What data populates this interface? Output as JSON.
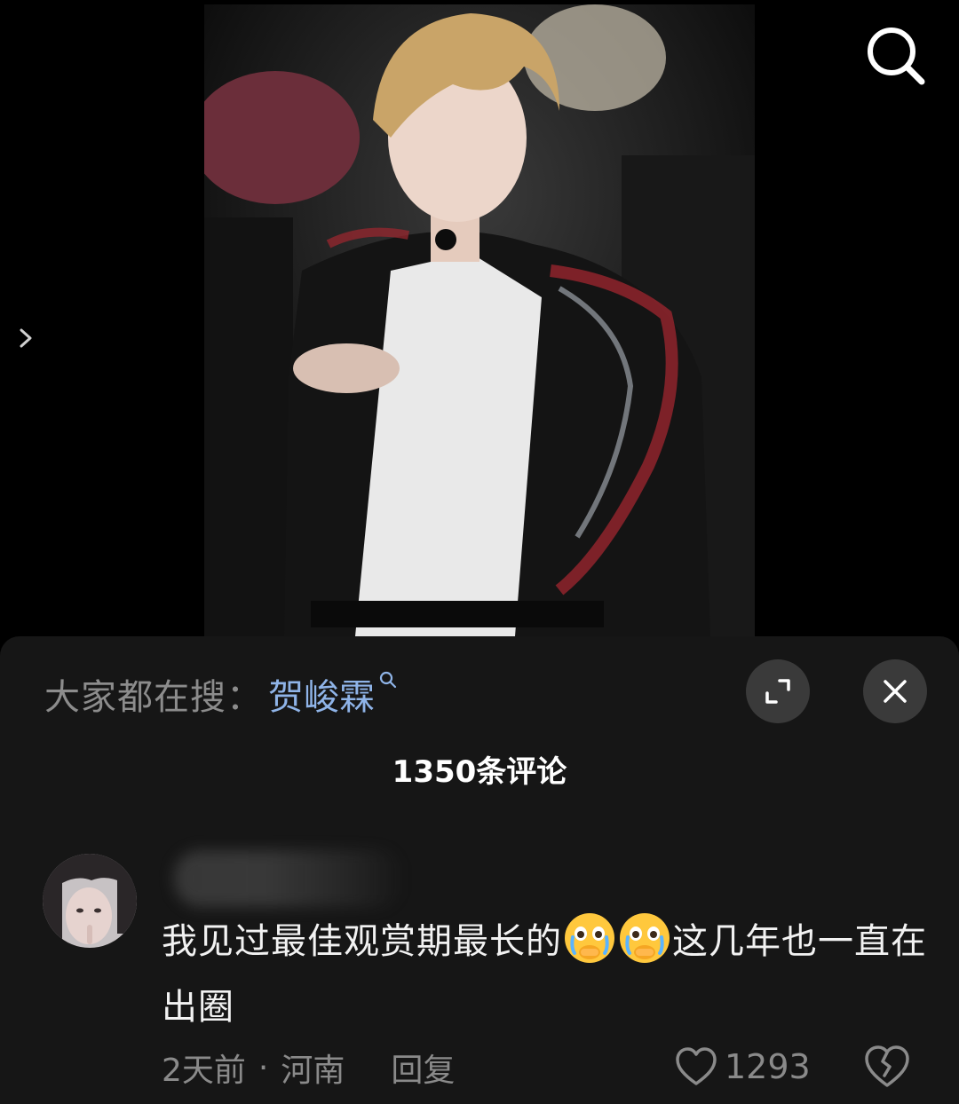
{
  "search": {
    "icon": "search-icon"
  },
  "hot_search": {
    "prefix": "大家都在搜：",
    "term": "贺峻霖"
  },
  "comments_header": {
    "count_label": "1350条评论"
  },
  "comment": {
    "text_parts": [
      "我见过最佳观赏期最长的",
      "这几年也一直在出圈"
    ],
    "emoji": "crying-face-emoji",
    "time": "2天前",
    "separator": "·",
    "location": "河南",
    "reply_label": "回复",
    "like_count": "1293"
  },
  "colors": {
    "sheet_bg": "#161616",
    "hot_term": "#8fb4e8",
    "muted_text": "#8a8a8a",
    "button_bg": "#3a3a3a"
  }
}
